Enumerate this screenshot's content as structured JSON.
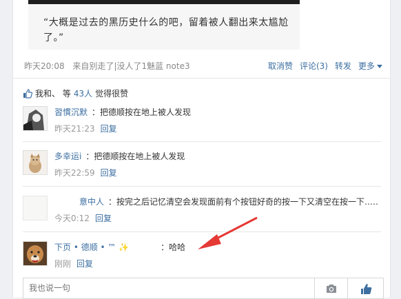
{
  "post": {
    "quote": "“大概是过去的黑历史什么的吧，留着被人翻出来太尴尬了。”",
    "time": "昨天20:08",
    "source_prefix": "来自",
    "source": "别走了|没人了1魅蓝 note3",
    "actions": {
      "unlike": "取消赞",
      "comment": "评论(3)",
      "repost": "转发",
      "more": "更多"
    }
  },
  "likes": {
    "prefix": "我和、 等",
    "count": "43人",
    "suffix": "觉得很赞"
  },
  "comments": [
    {
      "name": "習慣沉默",
      "text": "：把德顺按在地上被人发现",
      "time": "昨天21:23",
      "reply": "回复"
    },
    {
      "name": "多幸运i",
      "text": "：把德顺按在地上被人发现",
      "time": "昨天22:59",
      "reply": "回复"
    },
    {
      "name": "意中人",
      "text": "：按完之后记忆清空会发现面前有个按钮好奇的按一下又清空在按一下……",
      "time": "今天0:12",
      "reply": "回复"
    },
    {
      "name": "下页 • 德顺 • ™ ✨",
      "text": "：哈哈",
      "time": "刚刚",
      "reply": "回复"
    }
  ],
  "input": {
    "placeholder": "我也说一句"
  },
  "colors": {
    "link": "#3d6fa1",
    "arrow": "#e53935"
  }
}
